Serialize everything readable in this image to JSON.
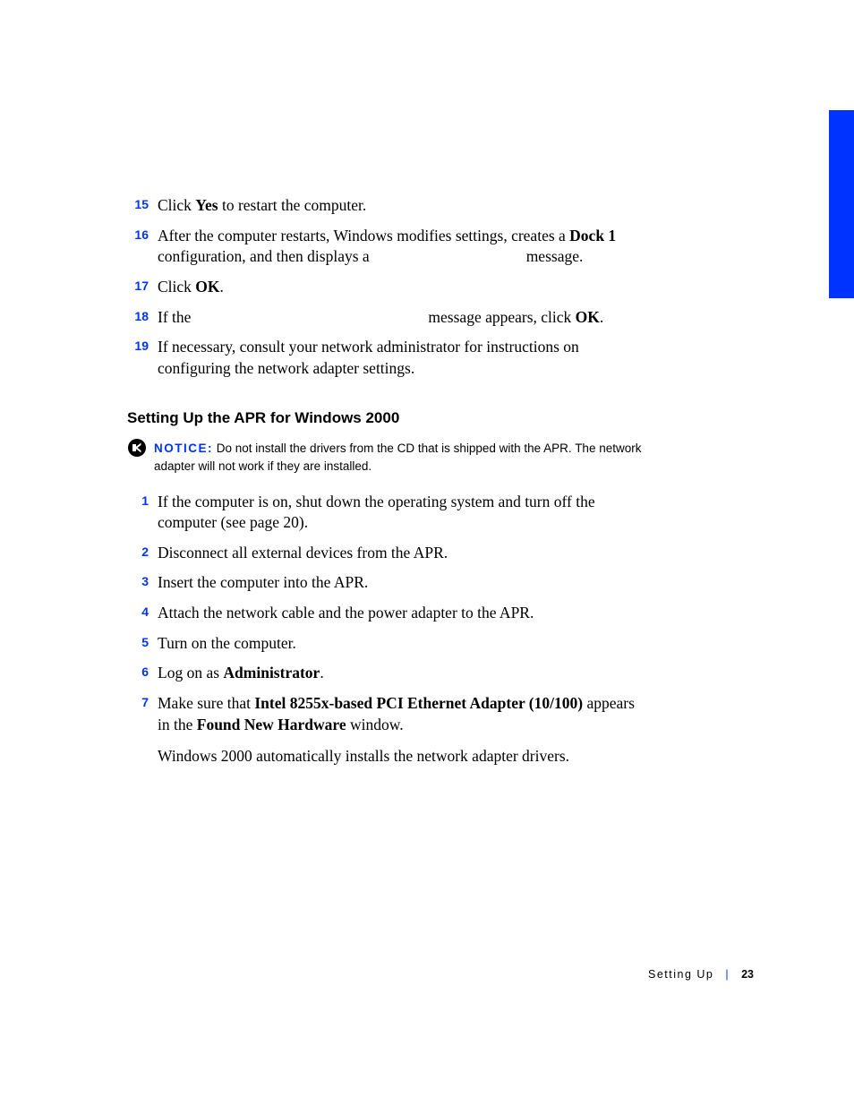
{
  "steps_top": [
    {
      "n": "15",
      "html": "Click <span class='b'>Yes</span> to restart the computer."
    },
    {
      "n": "16",
      "html": "After the computer restarts, Windows modifies settings, creates a <span class='b'>Dock 1</span> configuration, and then displays a<span class='gap' style='width:175px'></span>message."
    },
    {
      "n": "17",
      "html": "Click <span class='b'>OK</span>."
    },
    {
      "n": "18",
      "html": "If the<span class='gap' style='width:265px'></span>message appears, click <span class='b'>OK</span>."
    },
    {
      "n": "19",
      "html": "If necessary, consult your network administrator for instructions on configuring the network adapter settings."
    }
  ],
  "heading": "Setting Up the APR for Windows 2000",
  "notice": {
    "label": "NOTICE:",
    "text": " Do not install the drivers from the CD that is shipped with the APR. The network adapter will not work if they are installed."
  },
  "steps_bottom": [
    {
      "n": "1",
      "html": "If the computer is on, shut down the operating system and turn off the computer (see page 20)."
    },
    {
      "n": "2",
      "html": "Disconnect all external devices from the APR."
    },
    {
      "n": "3",
      "html": "Insert the computer into the APR."
    },
    {
      "n": "4",
      "html": "Attach the network cable and the power adapter to the APR."
    },
    {
      "n": "5",
      "html": "Turn on the computer."
    },
    {
      "n": "6",
      "html": "Log on as <span class='b'>Administrator</span>."
    },
    {
      "n": "7",
      "html": "Make sure that <span class='b'>Intel 8255x-based PCI Ethernet Adapter (10/100)</span> appears in the <span class='b'>Found New Hardware</span> window."
    }
  ],
  "post_para": "Windows 2000 automatically installs the network adapter drivers.",
  "footer": {
    "section": "Setting Up",
    "page": "23"
  }
}
